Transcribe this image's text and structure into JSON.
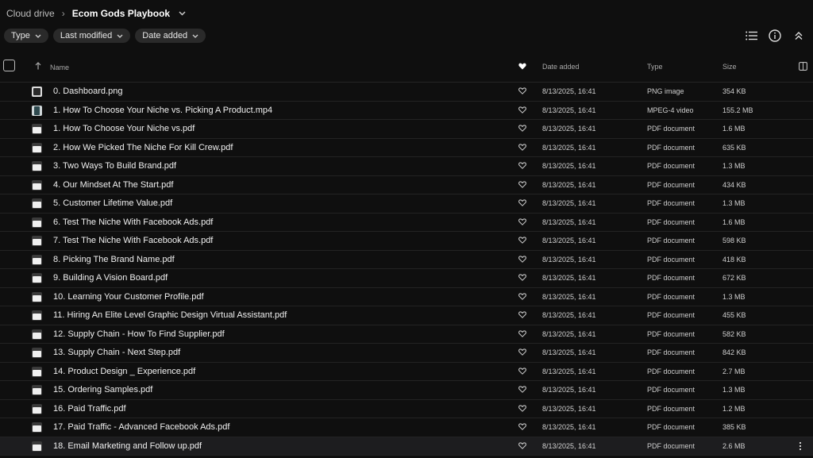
{
  "breadcrumb": {
    "root": "Cloud drive",
    "separator": "›",
    "current": "Ecom Gods Playbook"
  },
  "filters": [
    {
      "label": "Type"
    },
    {
      "label": "Last modified"
    },
    {
      "label": "Date added"
    }
  ],
  "toolbar": {
    "icons": [
      "list-view-icon",
      "info-icon",
      "collapse-icon"
    ]
  },
  "table": {
    "columns": {
      "name": "Name",
      "date_added": "Date added",
      "type": "Type",
      "size": "Size"
    },
    "rows": [
      {
        "name": "0. Dashboard.png",
        "date": "8/13/2025, 16:41",
        "type": "PNG image",
        "size": "354 KB",
        "icon": "image-file-icon"
      },
      {
        "name": "1. How To Choose Your Niche vs. Picking A Product.mp4",
        "date": "8/13/2025, 16:41",
        "type": "MPEG-4 video",
        "size": "155.2 MB",
        "icon": "video-file-icon"
      },
      {
        "name": "1. How To Choose Your Niche vs.pdf",
        "date": "8/13/2025, 16:41",
        "type": "PDF document",
        "size": "1.6 MB",
        "icon": "pdf-file-icon"
      },
      {
        "name": "2. How We Picked The Niche For Kill Crew.pdf",
        "date": "8/13/2025, 16:41",
        "type": "PDF document",
        "size": "635 KB",
        "icon": "pdf-file-icon"
      },
      {
        "name": "3. Two Ways To Build Brand.pdf",
        "date": "8/13/2025, 16:41",
        "type": "PDF document",
        "size": "1.3 MB",
        "icon": "pdf-file-icon"
      },
      {
        "name": "4. Our Mindset At The Start.pdf",
        "date": "8/13/2025, 16:41",
        "type": "PDF document",
        "size": "434 KB",
        "icon": "pdf-file-icon"
      },
      {
        "name": "5. Customer Lifetime Value.pdf",
        "date": "8/13/2025, 16:41",
        "type": "PDF document",
        "size": "1.3 MB",
        "icon": "pdf-file-icon"
      },
      {
        "name": "6. Test The Niche With Facebook Ads.pdf",
        "date": "8/13/2025, 16:41",
        "type": "PDF document",
        "size": "1.6 MB",
        "icon": "pdf-file-icon"
      },
      {
        "name": "7. Test The Niche With Facebook Ads.pdf",
        "date": "8/13/2025, 16:41",
        "type": "PDF document",
        "size": "598 KB",
        "icon": "pdf-file-icon"
      },
      {
        "name": "8. Picking The Brand Name.pdf",
        "date": "8/13/2025, 16:41",
        "type": "PDF document",
        "size": "418 KB",
        "icon": "pdf-file-icon"
      },
      {
        "name": "9. Building A Vision Board.pdf",
        "date": "8/13/2025, 16:41",
        "type": "PDF document",
        "size": "672 KB",
        "icon": "pdf-file-icon"
      },
      {
        "name": "10. Learning Your Customer Profile.pdf",
        "date": "8/13/2025, 16:41",
        "type": "PDF document",
        "size": "1.3 MB",
        "icon": "pdf-file-icon"
      },
      {
        "name": "11. Hiring An Elite Level Graphic Design Virtual Assistant.pdf",
        "date": "8/13/2025, 16:41",
        "type": "PDF document",
        "size": "455 KB",
        "icon": "pdf-file-icon"
      },
      {
        "name": "12. Supply Chain - How To Find Supplier.pdf",
        "date": "8/13/2025, 16:41",
        "type": "PDF document",
        "size": "582 KB",
        "icon": "pdf-file-icon"
      },
      {
        "name": "13. Supply Chain - Next Step.pdf",
        "date": "8/13/2025, 16:41",
        "type": "PDF document",
        "size": "842 KB",
        "icon": "pdf-file-icon"
      },
      {
        "name": "14. Product Design _ Experience.pdf",
        "date": "8/13/2025, 16:41",
        "type": "PDF document",
        "size": "2.7 MB",
        "icon": "pdf-file-icon"
      },
      {
        "name": "15. Ordering Samples.pdf",
        "date": "8/13/2025, 16:41",
        "type": "PDF document",
        "size": "1.3 MB",
        "icon": "pdf-file-icon"
      },
      {
        "name": "16. Paid Traffic.pdf",
        "date": "8/13/2025, 16:41",
        "type": "PDF document",
        "size": "1.2 MB",
        "icon": "pdf-file-icon"
      },
      {
        "name": "17. Paid Traffic - Advanced Facebook Ads.pdf",
        "date": "8/13/2025, 16:41",
        "type": "PDF document",
        "size": "385 KB",
        "icon": "pdf-file-icon"
      },
      {
        "name": "18. Email Marketing and Follow up.pdf",
        "date": "8/13/2025, 16:41",
        "type": "PDF document",
        "size": "2.6 MB",
        "icon": "pdf-file-icon",
        "selected": true
      }
    ]
  },
  "colors": {
    "background": "#0f0f0f",
    "chip": "#2a2a2a",
    "text": "#f0f0f0",
    "muted": "#cfcfcf",
    "row_border": "#232323",
    "selected_row": "#1d1d1f"
  }
}
